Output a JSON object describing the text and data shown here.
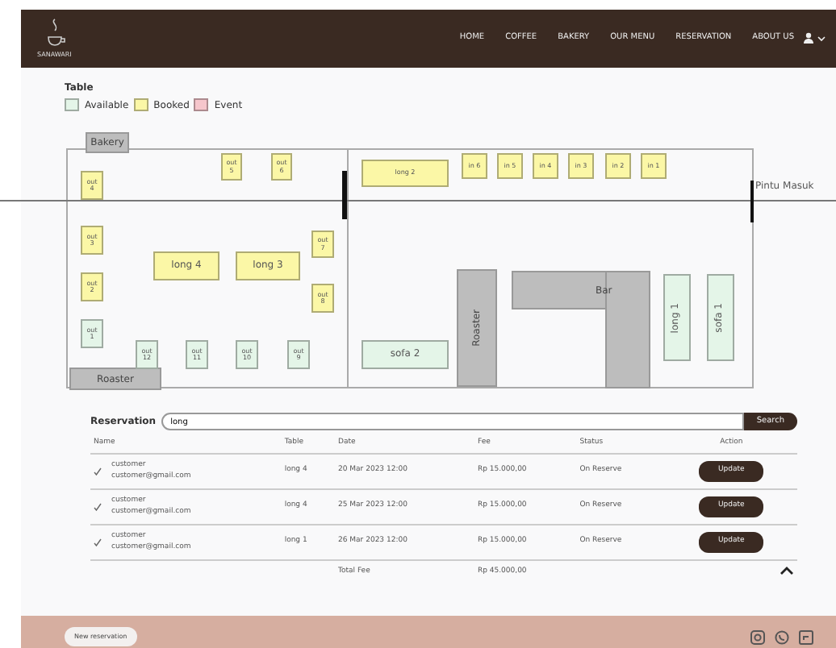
{
  "navbar": {
    "logo_text": "SANAWARI",
    "links": [
      "HOME",
      "COFFEE",
      "BAKERY",
      "OUR MENU",
      "RESERVATION",
      "ABOUT US"
    ]
  },
  "legend": {
    "title": "Table",
    "items": [
      {
        "label": "Available",
        "color": "#e4f5e8"
      },
      {
        "label": "Booked",
        "color": "#fbf7a6"
      },
      {
        "label": "Event",
        "color": "#f6c6cc"
      }
    ]
  },
  "floor": {
    "areas": [
      {
        "label": "Bakery",
        "kind": "label"
      },
      {
        "label": "Roaster",
        "kind": "label"
      },
      {
        "label": "Roaster",
        "kind": "vertical"
      },
      {
        "label": "Bar",
        "kind": "bar"
      }
    ],
    "door": "Pintu Masuk",
    "tables": [
      {
        "name": "out 4",
        "color": "#fbf7a6"
      },
      {
        "name": "out 5",
        "color": "#fbf7a6"
      },
      {
        "name": "out 6",
        "color": "#fbf7a6"
      },
      {
        "name": "long 2",
        "color": "#fbf7a6"
      },
      {
        "name": "in 6",
        "color": "#fbf7a6"
      },
      {
        "name": "in 5",
        "color": "#fbf7a6"
      },
      {
        "name": "in 4",
        "color": "#fbf7a6"
      },
      {
        "name": "in 3",
        "color": "#fbf7a6"
      },
      {
        "name": "in 2",
        "color": "#fbf7a6"
      },
      {
        "name": "in 1",
        "color": "#fbf7a6"
      },
      {
        "name": "out 3",
        "color": "#fbf7a6"
      },
      {
        "name": "out 2",
        "color": "#fbf7a6"
      },
      {
        "name": "out 1",
        "color": "#e4f5e8"
      },
      {
        "name": "long 4",
        "color": "#fbf7a6"
      },
      {
        "name": "long 3",
        "color": "#fbf7a6"
      },
      {
        "name": "out 7",
        "color": "#fbf7a6"
      },
      {
        "name": "out 8",
        "color": "#fbf7a6"
      },
      {
        "name": "out 12",
        "color": "#e4f5e8"
      },
      {
        "name": "out 11",
        "color": "#e4f5e8"
      },
      {
        "name": "out 10",
        "color": "#e4f5e8"
      },
      {
        "name": "out 9",
        "color": "#e4f5e8"
      },
      {
        "name": "sofa 2",
        "color": "#e4f5e8"
      },
      {
        "name": "long 1",
        "color": "#e4f5e8"
      },
      {
        "name": "sofa 1",
        "color": "#e4f5e8"
      }
    ]
  },
  "reservation": {
    "label": "Reservation",
    "search_value": "long",
    "search_button": "Search",
    "columns": [
      "Name",
      "Table",
      "Date",
      "Fee",
      "Status",
      "Action"
    ],
    "rows": [
      {
        "name": "customer",
        "email": "customer@gmail.com",
        "table": "long 4",
        "date": "20 Mar 2023 12:00",
        "fee": "Rp 15.000,00",
        "status": "On Reserve",
        "action": "Update"
      },
      {
        "name": "customer",
        "email": "customer@gmail.com",
        "table": "long 4",
        "date": "25 Mar 2023 12:00",
        "fee": "Rp 15.000,00",
        "status": "On Reserve",
        "action": "Update"
      },
      {
        "name": "customer",
        "email": "customer@gmail.com",
        "table": "long 1",
        "date": "26 Mar 2023 12:00",
        "fee": "Rp 15.000,00",
        "status": "On Reserve",
        "action": "Update"
      }
    ],
    "total_label": "Total Fee",
    "total_value": "Rp 45.000,00"
  },
  "footer": {
    "button": "New reservation"
  }
}
